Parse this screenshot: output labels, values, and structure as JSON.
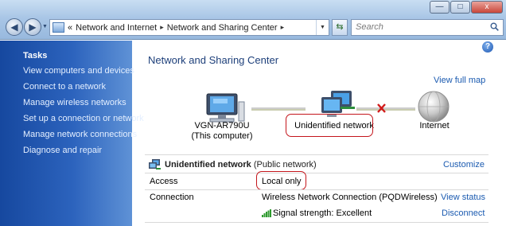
{
  "window": {
    "minimize_glyph": "—",
    "maximize_glyph": "□",
    "close_glyph": "x"
  },
  "nav": {
    "back_glyph": "◀",
    "forward_glyph": "▶",
    "recent_glyph": "▼",
    "refresh_glyph": "⇆"
  },
  "address": {
    "chevrons": "«",
    "crumbs": [
      "Network and Internet",
      "Network and Sharing Center"
    ],
    "separator": "▸",
    "dropdown_glyph": "▼"
  },
  "search": {
    "placeholder": "Search"
  },
  "sidebar": {
    "heading": "Tasks",
    "items": [
      "View computers and devices",
      "Connect to a network",
      "Manage wireless networks",
      "Set up a connection or network",
      "Manage network connections",
      "Diagnose and repair"
    ]
  },
  "main": {
    "help_glyph": "?",
    "title": "Network and Sharing Center",
    "view_full_map": "View full map",
    "map": {
      "computer_name": "VGN-AR790U",
      "computer_sub": "(This computer)",
      "network_name": "Unidentified network",
      "internet_label": "Internet",
      "broken_link": true
    },
    "network": {
      "name": "Unidentified network",
      "type": "(Public network)",
      "customize": "Customize"
    },
    "rows": {
      "access_label": "Access",
      "access_value": "Local only",
      "connection_label": "Connection",
      "connection_value": "Wireless Network Connection (PQDWireless)",
      "view_status": "View status",
      "signal_value": "Signal strength:  Excellent",
      "disconnect": "Disconnect"
    }
  },
  "colors": {
    "sidebar_top": "#16489f",
    "sidebar_link": "#e4efff",
    "link": "#1a5ab0",
    "title": "#1d3f7a",
    "highlight": "#c4161c",
    "broken_x": "#d11a1a"
  },
  "icons": [
    "computer-icon",
    "network-icon",
    "internet-globe-icon",
    "broken-connection-icon",
    "signal-bars-icon",
    "help-icon",
    "search-icon"
  ]
}
